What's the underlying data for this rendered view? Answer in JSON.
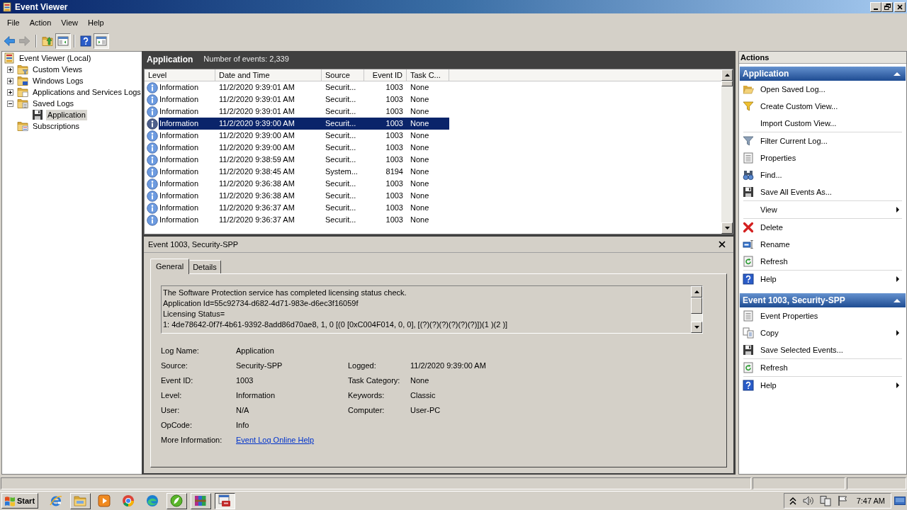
{
  "window": {
    "title": "Event Viewer"
  },
  "menu": [
    "File",
    "Action",
    "View",
    "Help"
  ],
  "toolbar": [
    [
      {
        "kind": "back",
        "disabled": false,
        "on": false
      },
      {
        "kind": "forward",
        "disabled": true,
        "on": false
      }
    ],
    [
      {
        "kind": "up",
        "disabled": false,
        "on": false
      },
      {
        "kind": "console_tree",
        "disabled": false,
        "on": true
      }
    ],
    [
      {
        "kind": "help",
        "disabled": false,
        "on": false
      },
      {
        "kind": "action_pane",
        "disabled": false,
        "on": true
      }
    ]
  ],
  "tree": [
    {
      "label": "Event Viewer (Local)",
      "kind": "root",
      "selected": false,
      "children": [
        {
          "label": "Custom Views",
          "kind": "custom_views",
          "selected": false,
          "expanded": false
        },
        {
          "label": "Windows Logs",
          "kind": "windows_logs",
          "selected": false,
          "expanded": false
        },
        {
          "label": "Applications and Services Logs",
          "kind": "app_logs",
          "selected": false,
          "expanded": false
        },
        {
          "label": "Saved Logs",
          "kind": "saved_logs",
          "selected": false,
          "expanded": true,
          "children": [
            {
              "label": "Application",
              "kind": "saved_log",
              "selected": true
            }
          ]
        },
        {
          "label": "Subscriptions",
          "kind": "subscriptions",
          "selected": false
        }
      ]
    }
  ],
  "events": {
    "title": "Application",
    "summary": "Number of events: 2,339",
    "columns": [
      "Level",
      "Date and Time",
      "Source",
      "Event ID",
      "Task C..."
    ],
    "rows": [
      {
        "level": "Information",
        "date_time": "11/2/2020 9:39:01 AM",
        "source": "Securit...",
        "event_id": "1003",
        "task_category": "None",
        "selected": false
      },
      {
        "level": "Information",
        "date_time": "11/2/2020 9:39:01 AM",
        "source": "Securit...",
        "event_id": "1003",
        "task_category": "None",
        "selected": false
      },
      {
        "level": "Information",
        "date_time": "11/2/2020 9:39:01 AM",
        "source": "Securit...",
        "event_id": "1003",
        "task_category": "None",
        "selected": false
      },
      {
        "level": "Information",
        "date_time": "11/2/2020 9:39:00 AM",
        "source": "Securit...",
        "event_id": "1003",
        "task_category": "None",
        "selected": true
      },
      {
        "level": "Information",
        "date_time": "11/2/2020 9:39:00 AM",
        "source": "Securit...",
        "event_id": "1003",
        "task_category": "None",
        "selected": false
      },
      {
        "level": "Information",
        "date_time": "11/2/2020 9:39:00 AM",
        "source": "Securit...",
        "event_id": "1003",
        "task_category": "None",
        "selected": false
      },
      {
        "level": "Information",
        "date_time": "11/2/2020 9:38:59 AM",
        "source": "Securit...",
        "event_id": "1003",
        "task_category": "None",
        "selected": false
      },
      {
        "level": "Information",
        "date_time": "11/2/2020 9:38:45 AM",
        "source": "System...",
        "event_id": "8194",
        "task_category": "None",
        "selected": false
      },
      {
        "level": "Information",
        "date_time": "11/2/2020 9:36:38 AM",
        "source": "Securit...",
        "event_id": "1003",
        "task_category": "None",
        "selected": false
      },
      {
        "level": "Information",
        "date_time": "11/2/2020 9:36:38 AM",
        "source": "Securit...",
        "event_id": "1003",
        "task_category": "None",
        "selected": false
      },
      {
        "level": "Information",
        "date_time": "11/2/2020 9:36:37 AM",
        "source": "Securit...",
        "event_id": "1003",
        "task_category": "None",
        "selected": false
      },
      {
        "level": "Information",
        "date_time": "11/2/2020 9:36:37 AM",
        "source": "Securit...",
        "event_id": "1003",
        "task_category": "None",
        "selected": false
      }
    ]
  },
  "event_detail": {
    "title": "Event 1003, Security-SPP",
    "tabs": [
      {
        "label": "General",
        "selected": true
      },
      {
        "label": "Details",
        "selected": false
      }
    ],
    "message": [
      "The Software Protection service has completed licensing status check.",
      "Application Id=55c92734-d682-4d71-983e-d6ec3f16059f",
      "Licensing Status=",
      "1: 4de78642-0f7f-4b61-9392-8add86d70ae8, 1, 0 [(0 [0xC004F014, 0, 0], [(?)(?)(?)(?)(?)(?)])(1 )(2 )]"
    ],
    "fields": [
      [
        {
          "label": "Log Name:",
          "value": "Application"
        }
      ],
      [
        {
          "label": "Source:",
          "value": "Security-SPP"
        },
        {
          "label": "Logged:",
          "value": "11/2/2020 9:39:00 AM"
        }
      ],
      [
        {
          "label": "Event ID:",
          "value": "1003"
        },
        {
          "label": "Task Category:",
          "value": "None"
        }
      ],
      [
        {
          "label": "Level:",
          "value": "Information"
        },
        {
          "label": "Keywords:",
          "value": "Classic"
        }
      ],
      [
        {
          "label": "User:",
          "value": "N/A"
        },
        {
          "label": "Computer:",
          "value": "User-PC"
        }
      ],
      [
        {
          "label": "OpCode:",
          "value": "Info"
        }
      ]
    ],
    "more_information": {
      "label": "More Information:",
      "link": "Event Log Online Help"
    }
  },
  "actions": {
    "title": "Actions",
    "sections": [
      {
        "title": "Application",
        "expanded": true,
        "groups": [
          [
            {
              "label": "Open Saved Log...",
              "kind": "open",
              "submenu": false
            },
            {
              "label": "Create Custom View...",
              "kind": "create_view",
              "submenu": false
            },
            {
              "label": "Import Custom View...",
              "kind": "none",
              "submenu": false
            }
          ],
          [
            {
              "label": "Filter Current Log...",
              "kind": "filter",
              "submenu": false
            },
            {
              "label": "Properties",
              "kind": "properties",
              "submenu": false
            },
            {
              "label": "Find...",
              "kind": "find",
              "submenu": false
            },
            {
              "label": "Save All Events As...",
              "kind": "save",
              "submenu": false
            }
          ],
          [
            {
              "label": "View",
              "kind": "none",
              "submenu": true
            }
          ],
          [
            {
              "label": "Delete",
              "kind": "delete",
              "submenu": false
            },
            {
              "label": "Rename",
              "kind": "rename",
              "submenu": false
            },
            {
              "label": "Refresh",
              "kind": "refresh",
              "submenu": false
            }
          ],
          [
            {
              "label": "Help",
              "kind": "help",
              "submenu": true
            }
          ]
        ]
      },
      {
        "title": "Event 1003, Security-SPP",
        "expanded": true,
        "groups": [
          [
            {
              "label": "Event Properties",
              "kind": "properties",
              "submenu": false
            },
            {
              "label": "Copy",
              "kind": "copy",
              "submenu": true
            },
            {
              "label": "Save Selected Events...",
              "kind": "save",
              "submenu": false
            }
          ],
          [
            {
              "label": "Refresh",
              "kind": "refresh",
              "submenu": false
            }
          ],
          [
            {
              "label": "Help",
              "kind": "help",
              "submenu": true
            }
          ]
        ]
      }
    ]
  },
  "taskbar": {
    "start": "Start",
    "apps": [
      {
        "kind": "ie",
        "running": false,
        "selected": false
      },
      {
        "kind": "explorer",
        "running": true,
        "selected": false
      },
      {
        "kind": "media",
        "running": false,
        "selected": false
      },
      {
        "kind": "chrome",
        "running": false,
        "selected": false
      },
      {
        "kind": "edge",
        "running": false,
        "selected": false
      },
      {
        "kind": "green",
        "running": true,
        "selected": false
      },
      {
        "kind": "archive",
        "running": true,
        "selected": false
      },
      {
        "kind": "event_viewer",
        "running": true,
        "selected": true
      }
    ],
    "clock": "7:47 AM"
  }
}
